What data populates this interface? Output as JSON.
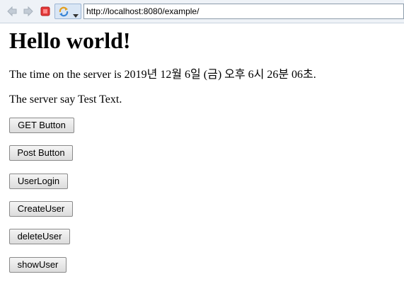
{
  "browser": {
    "url": "http://localhost:8080/example/",
    "icons": [
      "back-arrow-icon",
      "forward-arrow-icon",
      "stop-icon",
      "refresh-icon",
      "chevron-down-icon"
    ]
  },
  "page": {
    "heading": "Hello world!",
    "time_text": "The time on the server is 2019년 12월 6일 (금) 오후 6시 26분 06초.",
    "say_text": "The server say Test Text.",
    "buttons": {
      "get": "GET Button",
      "post": "Post Button",
      "login": "UserLogin",
      "create": "CreateUser",
      "delete": "deleteUser",
      "show": "showUser"
    }
  }
}
